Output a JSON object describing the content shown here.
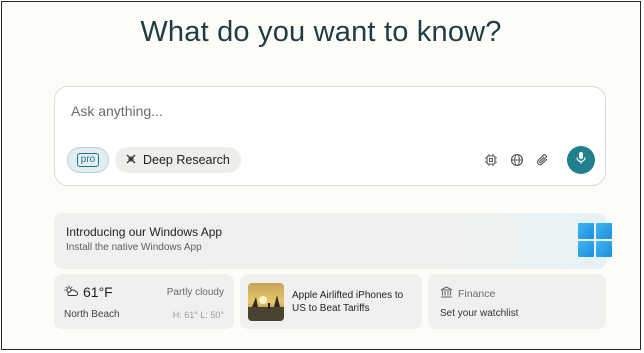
{
  "headline": "What do you want to know?",
  "search": {
    "placeholder": "Ask anything...",
    "pro_label": "pro",
    "deep_research_label": "Deep Research"
  },
  "promo": {
    "title": "Introducing our Windows App",
    "subtitle": "Install the native Windows App"
  },
  "weather": {
    "temperature": "61°F",
    "condition": "Partly cloudy",
    "location": "North Beach",
    "high_low": "H: 61° L: 50°"
  },
  "news": {
    "title": "Apple Airlifted iPhones to US to Beat Tariffs"
  },
  "finance": {
    "label": "Finance",
    "subtitle": "Set your watchlist"
  },
  "colors": {
    "accent": "#21808d",
    "heading": "#1f3b44"
  },
  "icons": [
    "cpu-icon",
    "globe-icon",
    "paperclip-icon",
    "mic-icon",
    "deep-research-icon",
    "sun-cloud-icon",
    "bank-icon",
    "windows-logo-icon"
  ]
}
